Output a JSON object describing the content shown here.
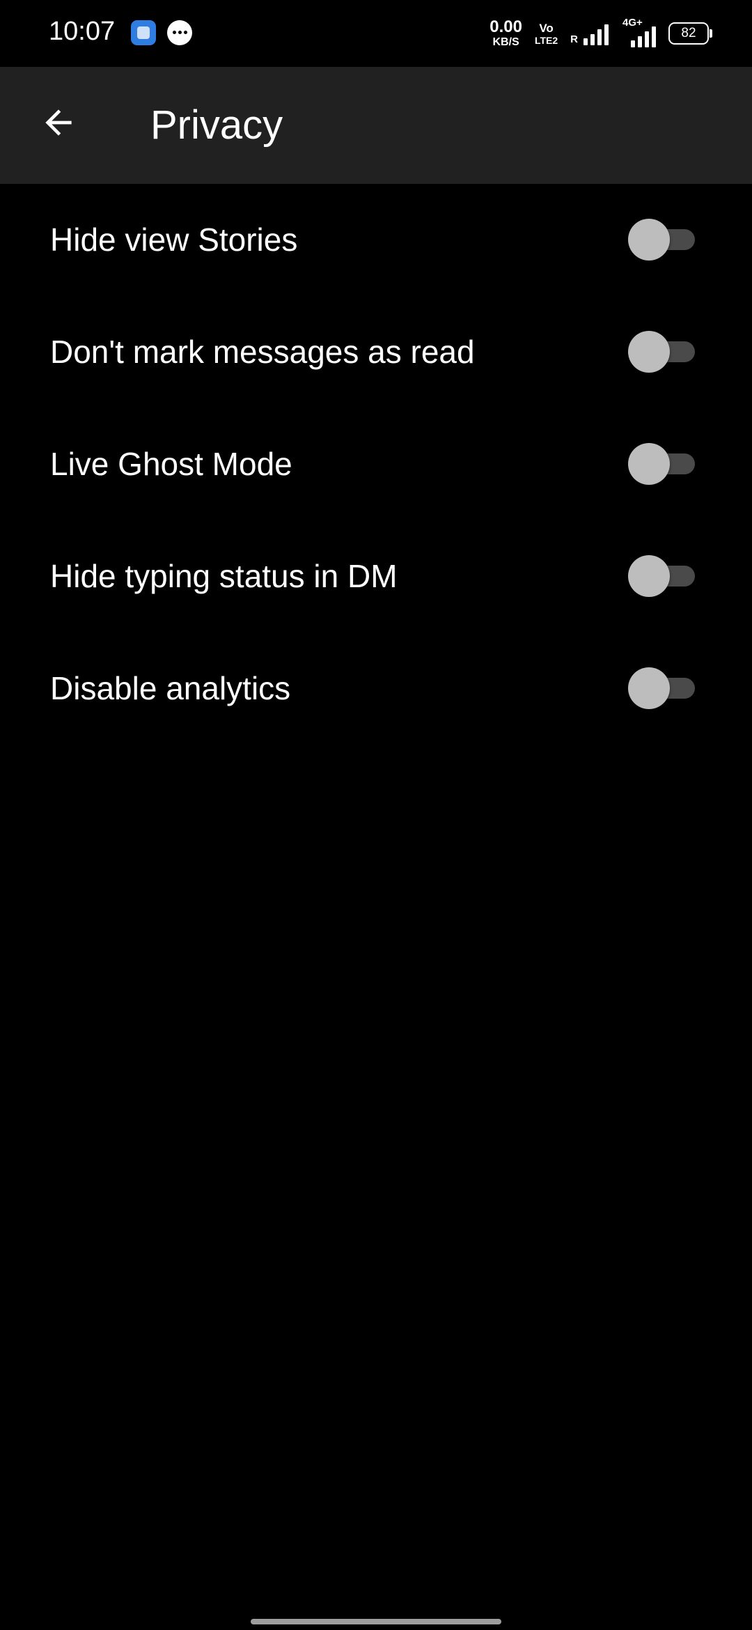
{
  "status_bar": {
    "time": "10:07",
    "notification_icons": [
      "app-notification-icon",
      "chat-bubble-icon"
    ],
    "net_speed_value": "0.00",
    "net_speed_unit": "KB/S",
    "volte_top": "Vo",
    "volte_bottom": "LTE2",
    "sim1_label": "R",
    "sim2_label": "4G+",
    "battery_level": "82"
  },
  "app_bar": {
    "back_icon": "arrow-left-icon",
    "title": "Privacy"
  },
  "settings": [
    {
      "label": "Hide view Stories",
      "enabled": false
    },
    {
      "label": "Don't mark messages as read",
      "enabled": false
    },
    {
      "label": "Live Ghost Mode",
      "enabled": false
    },
    {
      "label": "Hide typing status in DM",
      "enabled": false
    },
    {
      "label": "Disable analytics",
      "enabled": false
    }
  ],
  "colors": {
    "background": "#000000",
    "app_bar": "#212121",
    "text": "#ffffff",
    "toggle_track_off": "#4a4a4a",
    "toggle_thumb_off": "#bdbdbd"
  }
}
